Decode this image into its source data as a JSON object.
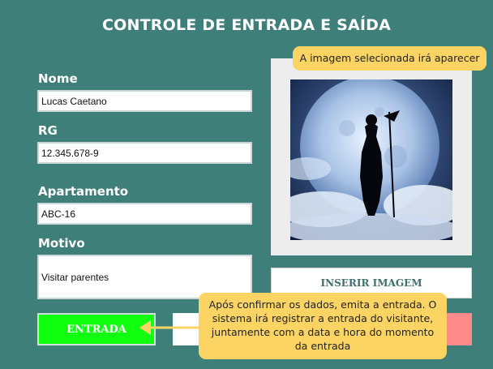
{
  "header": {
    "title": "CONTROLE DE ENTRADA E SAÍDA"
  },
  "form": {
    "nome_label": "Nome",
    "nome_value": "Lucas Caetano",
    "rg_label": "RG",
    "rg_value": "12.345.678-9",
    "apartamento_label": "Apartamento",
    "apartamento_value": "ABC-16",
    "motivo_label": "Motivo",
    "motivo_value": "Visitar parentes"
  },
  "image_panel": {
    "insert_button_label": "INSERIR IMAGEM"
  },
  "actions": {
    "entrada_label": "ENTRADA"
  },
  "tooltips": {
    "image_hint": "A imagem selecionada irá aparecer",
    "entrada_hint": "Após confirmar os dados, emita a entrada. O sistema irá registrar a entrada do visitante, juntamente com a data e hora do momento da entrada"
  },
  "colors": {
    "background": "#3f7f7a",
    "entrada_button": "#11ff11",
    "saida_button": "#ff8a8a",
    "tooltip": "#fbd464"
  }
}
